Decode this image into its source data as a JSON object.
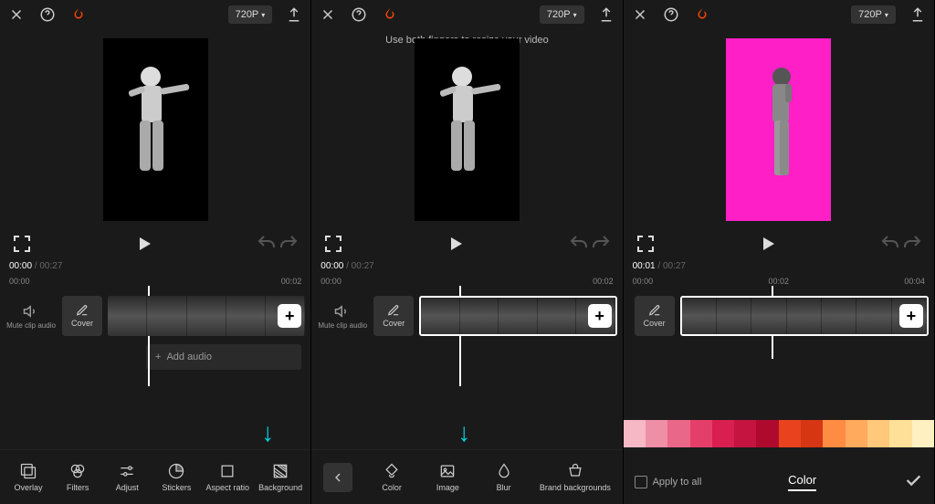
{
  "header": {
    "resolution": "720P"
  },
  "hint": "Use both fingers to resize your video",
  "controls": {
    "play": "▶",
    "undo": "↶",
    "redo": "↷",
    "expand": "⛶"
  },
  "time": {
    "s1": {
      "current": "00:00",
      "total": "00:27",
      "marks": [
        "00:00",
        "00:02"
      ]
    },
    "s2": {
      "current": "00:00",
      "total": "00:27",
      "marks": [
        "00:00",
        "00:02"
      ]
    },
    "s3": {
      "current": "00:01",
      "total": "00:27",
      "marks": [
        "00:00",
        "00:02",
        "00:04"
      ]
    }
  },
  "timeline": {
    "mute": "Mute clip audio",
    "cover": "Cover",
    "addAudio": "Add audio",
    "plus": "+"
  },
  "nav1": [
    {
      "id": "overlay",
      "label": "Overlay"
    },
    {
      "id": "filters",
      "label": "Filters"
    },
    {
      "id": "adjust",
      "label": "Adjust"
    },
    {
      "id": "stickers",
      "label": "Stickers"
    },
    {
      "id": "aspect",
      "label": "Aspect ratio"
    },
    {
      "id": "background",
      "label": "Background"
    }
  ],
  "nav2": [
    {
      "id": "color",
      "label": "Color"
    },
    {
      "id": "image",
      "label": "Image"
    },
    {
      "id": "blur",
      "label": "Blur"
    },
    {
      "id": "brand",
      "label": "Brand backgrounds"
    }
  ],
  "colorPicker": {
    "applyAll": "Apply to all",
    "tab": "Color",
    "swatches": [
      "#f5b8c4",
      "#ee8fa6",
      "#e96788",
      "#e43f6a",
      "#d91e50",
      "#c4143f",
      "#af0a2e",
      "#e8431e",
      "#d63614",
      "#ff8c42",
      "#ffaa5c",
      "#ffc87a",
      "#ffe099",
      "#fff0c2"
    ]
  }
}
